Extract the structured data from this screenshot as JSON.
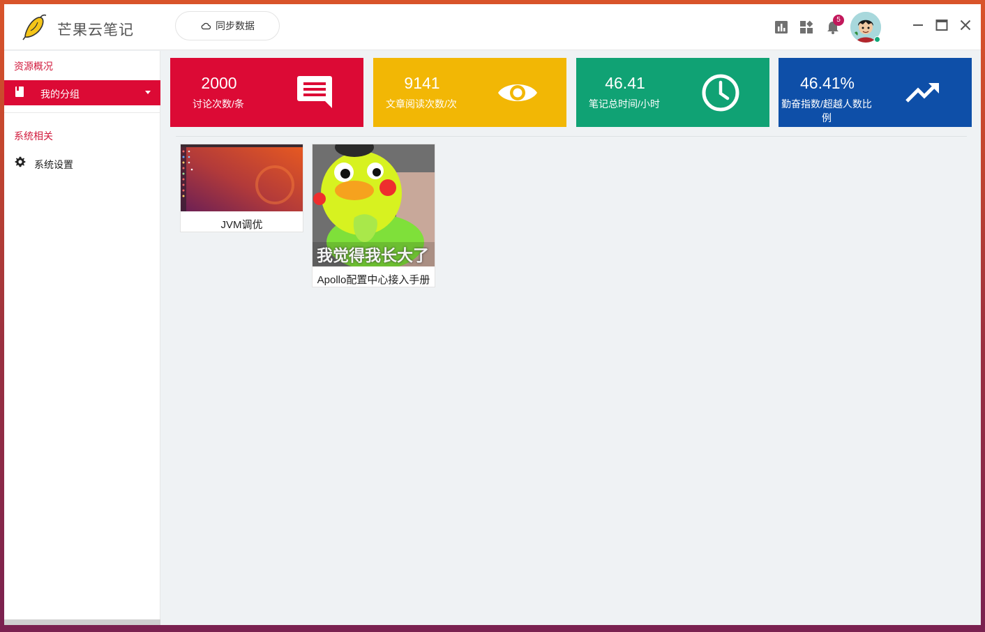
{
  "app": {
    "title": "芒果云笔记"
  },
  "header": {
    "sync_label": "同步数据",
    "notification_count": "5"
  },
  "sidebar": {
    "section_resources": "资源概况",
    "active_item": "我的分组",
    "section_system": "系统相关",
    "settings_item": "系统设置"
  },
  "stats": [
    {
      "value": "2000",
      "label": "讨论次数/条",
      "color": "#dc0a35",
      "icon": "message-icon"
    },
    {
      "value": "9141",
      "label": "文章阅读次数/次",
      "color": "#f2b705",
      "icon": "eye-icon"
    },
    {
      "value": "46.41",
      "label": "笔记总时间/小时",
      "color": "#10a274",
      "icon": "clock-icon"
    },
    {
      "value": "46.41%",
      "label": "勤奋指数/超越人数比例",
      "color": "#0e4fa8",
      "icon": "trending-up-icon"
    }
  ],
  "notes": [
    {
      "title": "JVM调优"
    },
    {
      "title": "Apollo配置中心接入手册",
      "image_caption": "我觉得我长大了"
    }
  ]
}
